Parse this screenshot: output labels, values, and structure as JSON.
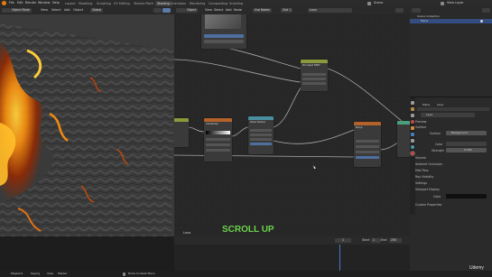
{
  "menu": [
    "File",
    "Edit",
    "Render",
    "Window",
    "Help"
  ],
  "workspaces": [
    "Layout",
    "Modeling",
    "Sculpting",
    "UV Editing",
    "Texture Paint",
    "Shading",
    "Animation",
    "Rendering",
    "Compositing",
    "Scripting"
  ],
  "active_workspace": "Layout",
  "scene_name": "Scene",
  "view_layer": "View Layer",
  "viewport_header": {
    "mode": "Object Mode",
    "items": [
      "View",
      "Select",
      "Add",
      "Object"
    ],
    "orientation": "Global"
  },
  "node_header": {
    "type": "Object",
    "items": [
      "View",
      "Select",
      "Add",
      "Node"
    ],
    "use_nodes": "Use Nodes",
    "slot": "Slot 1",
    "material": "Lava"
  },
  "nodes": {
    "principled": {
      "title": "Principled BSDF"
    },
    "output": {
      "title": "Material Output",
      "sockets": [
        "All",
        "Surface",
        "Volume",
        "Displacement"
      ]
    },
    "colorramp": {
      "title": "ColorRamp"
    },
    "noise": {
      "title": "Noise Texture"
    },
    "bump": {
      "title": "Bump"
    }
  },
  "outliner": {
    "title": "Scene Collection",
    "item": "Plane"
  },
  "properties": {
    "breadcrumb": [
      "Plane",
      "Lava"
    ],
    "material_name": "Lava",
    "sections": [
      "Preview",
      "Surface"
    ],
    "surface_label": "Surface",
    "surface_value": "Background",
    "color_label": "Color",
    "strength_label": "Strength",
    "strength_value": "0.500",
    "collapsed": [
      "Volume",
      "Ambient Occlusion",
      "Mist Pass",
      "Ray Visibility",
      "Settings",
      "Viewport Display"
    ],
    "viewport_color_label": "Color",
    "custom_properties": "Custom Properties"
  },
  "caption": "SCROLL UP",
  "timeline": {
    "label": "Lava",
    "start_label": "Start",
    "start": "1",
    "end_label": "End",
    "end": "250",
    "current": "1"
  },
  "statusbar": {
    "items": [
      "Playback",
      "Keying",
      "View",
      "Marker"
    ],
    "hint": "Node Context Menu"
  },
  "watermark": "Udemy",
  "colors": {
    "caption": "#6bd14b",
    "header_input": "#4b8a3a",
    "header_texture": "#b4622a",
    "header_shader": "#4a9f7a",
    "header_vector": "#6a5fb0"
  }
}
